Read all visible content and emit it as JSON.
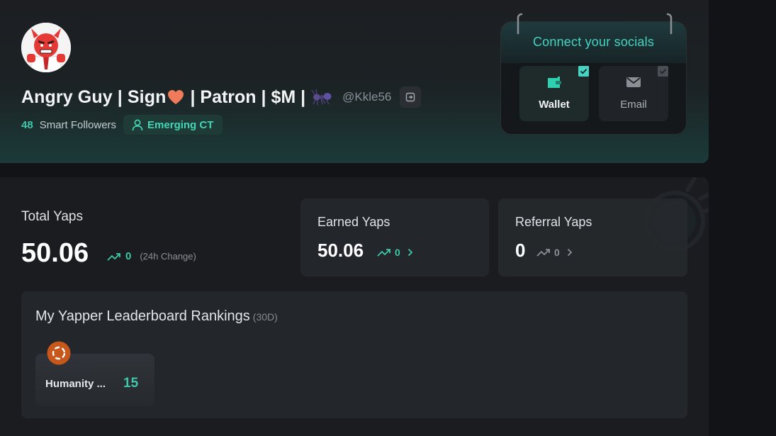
{
  "profile": {
    "name": "Angry Guy | Sign",
    "name_suffix": "| Patron | $M |",
    "handle": "@Kkle56",
    "smart_followers_count": "48",
    "smart_followers_label": "Smart Followers",
    "tier_badge": "Emerging CT"
  },
  "socials": {
    "title": "Connect your socials",
    "items": [
      {
        "label": "Wallet",
        "icon": "wallet-icon",
        "connected": true
      },
      {
        "label": "Email",
        "icon": "mail-icon",
        "connected": false
      }
    ]
  },
  "stats": {
    "total_label": "Total Yaps",
    "total_value": "50.06",
    "total_change": "0",
    "total_change_note": "(24h Change)",
    "earned_label": "Earned Yaps",
    "earned_value": "50.06",
    "earned_change": "0",
    "referral_label": "Referral Yaps",
    "referral_value": "0",
    "referral_change": "0"
  },
  "leaderboard": {
    "title": "My Yapper Leaderboard Rankings",
    "period": "(30D)",
    "rankings": [
      {
        "name": "Humanity ...",
        "rank": "15",
        "icon": "humanity-logo-icon"
      }
    ]
  },
  "colors": {
    "accent": "#3ec7a9",
    "socials_title": "#46d3c2",
    "background": "#121316",
    "card": "#23262a"
  }
}
